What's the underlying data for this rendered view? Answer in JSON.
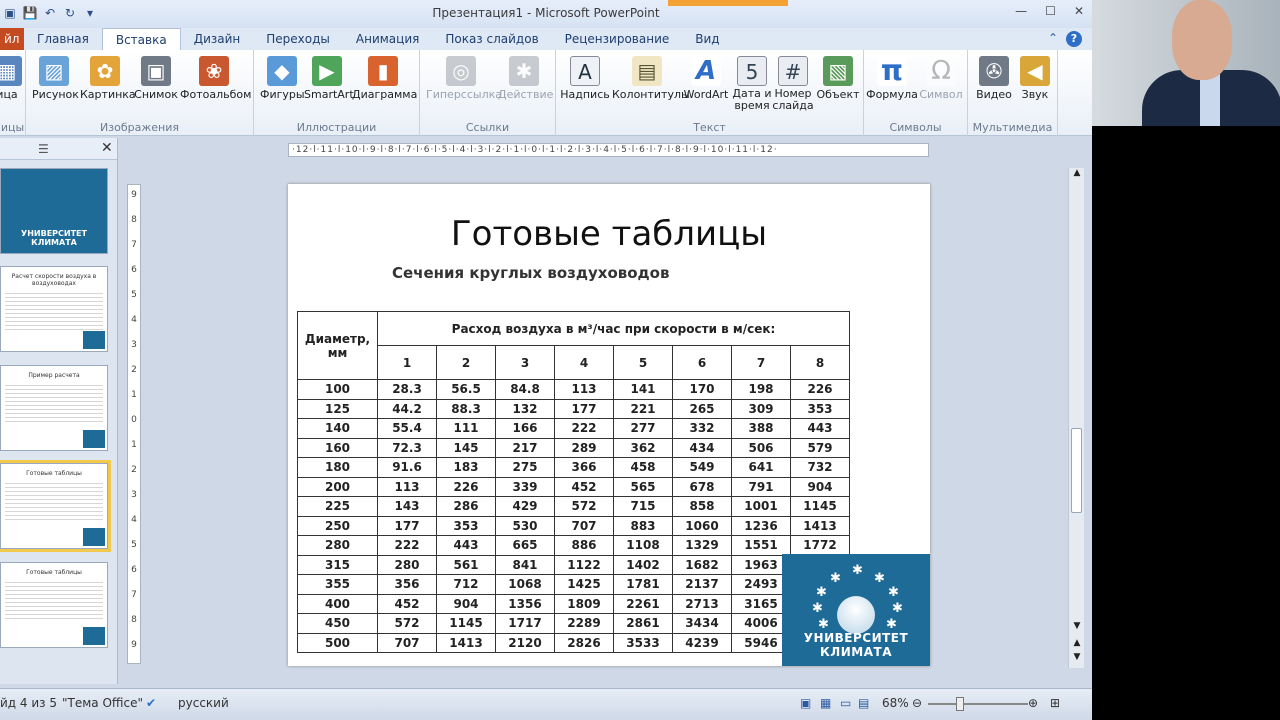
{
  "window": {
    "title": "Презентация1 - Microsoft PowerPoint"
  },
  "tabs": [
    {
      "label": "йл"
    },
    {
      "label": "Главная"
    },
    {
      "label": "Вставка"
    },
    {
      "label": "Дизайн"
    },
    {
      "label": "Переходы"
    },
    {
      "label": "Анимация"
    },
    {
      "label": "Показ слайдов"
    },
    {
      "label": "Рецензирование"
    },
    {
      "label": "Вид"
    }
  ],
  "ribbon": {
    "groups": [
      {
        "label": "ицы"
      },
      {
        "label": "Изображения"
      },
      {
        "label": "Иллюстрации"
      },
      {
        "label": "Ссылки"
      },
      {
        "label": "Текст"
      },
      {
        "label": "Символы"
      },
      {
        "label": "Мультимедиа"
      }
    ],
    "buttons": [
      {
        "label": "ица"
      },
      {
        "label": "Рисунок"
      },
      {
        "label": "Картинка"
      },
      {
        "label": "Снимок"
      },
      {
        "label": "Фотоальбом"
      },
      {
        "label": "Фигуры"
      },
      {
        "label": "SmartArt"
      },
      {
        "label": "Диаграмма"
      },
      {
        "label": "Гиперссылка"
      },
      {
        "label": "Действие"
      },
      {
        "label": "Надпись"
      },
      {
        "label": "Колонтитулы"
      },
      {
        "label": "WordArt"
      },
      {
        "label": "Дата и"
      },
      {
        "label": "время"
      },
      {
        "label": "Номер"
      },
      {
        "label": "слайда"
      },
      {
        "label": "Объект"
      },
      {
        "label": "Формула"
      },
      {
        "label": "Символ"
      },
      {
        "label": "Видео"
      },
      {
        "label": "Звук"
      }
    ]
  },
  "slides_pane": {
    "thumbs": [
      {
        "title": "УНИВЕРСИТЕТ КЛИМАТА"
      },
      {
        "title": "Расчет скорости воздуха в воздуховодах"
      },
      {
        "title": "Пример расчета"
      },
      {
        "title": "Готовые таблицы"
      },
      {
        "title": "Готовые таблицы"
      }
    ]
  },
  "rulers": {
    "horizontal": "·12·l·11·l·10·l·9·l·8·l·7·l·6·l·5·l·4·l·3·l·2·l·1·l·0·l·1·l·2·l·3·l·4·l·5·l·6·l·7·l·8·l·9·l·10·l·11·l·12·",
    "vertical": [
      "9",
      "8",
      "7",
      "6",
      "5",
      "4",
      "3",
      "2",
      "1",
      "0",
      "1",
      "2",
      "3",
      "4",
      "5",
      "6",
      "7",
      "8",
      "9"
    ]
  },
  "slide": {
    "title": "Готовые таблицы",
    "subtitle": "Сечения круглых воздуховодов",
    "table": {
      "col_header": "Диаметр, мм",
      "group_header": "Расход воздуха в м³/час при скорости в м/сек:",
      "speeds": [
        "1",
        "2",
        "3",
        "4",
        "5",
        "6",
        "7",
        "8"
      ],
      "rows": [
        [
          "100",
          "28.3",
          "56.5",
          "84.8",
          "113",
          "141",
          "170",
          "198",
          "226"
        ],
        [
          "125",
          "44.2",
          "88.3",
          "132",
          "177",
          "221",
          "265",
          "309",
          "353"
        ],
        [
          "140",
          "55.4",
          "111",
          "166",
          "222",
          "277",
          "332",
          "388",
          "443"
        ],
        [
          "160",
          "72.3",
          "145",
          "217",
          "289",
          "362",
          "434",
          "506",
          "579"
        ],
        [
          "180",
          "91.6",
          "183",
          "275",
          "366",
          "458",
          "549",
          "641",
          "732"
        ],
        [
          "200",
          "113",
          "226",
          "339",
          "452",
          "565",
          "678",
          "791",
          "904"
        ],
        [
          "225",
          "143",
          "286",
          "429",
          "572",
          "715",
          "858",
          "1001",
          "1145"
        ],
        [
          "250",
          "177",
          "353",
          "530",
          "707",
          "883",
          "1060",
          "1236",
          "1413"
        ],
        [
          "280",
          "222",
          "443",
          "665",
          "886",
          "1108",
          "1329",
          "1551",
          "1772"
        ],
        [
          "315",
          "280",
          "561",
          "841",
          "1122",
          "1402",
          "1682",
          "1963",
          ""
        ],
        [
          "355",
          "356",
          "712",
          "1068",
          "1425",
          "1781",
          "2137",
          "2493",
          ""
        ],
        [
          "400",
          "452",
          "904",
          "1356",
          "1809",
          "2261",
          "2713",
          "3165",
          ""
        ],
        [
          "450",
          "572",
          "1145",
          "1717",
          "2289",
          "2861",
          "3434",
          "4006",
          ""
        ],
        [
          "500",
          "707",
          "1413",
          "2120",
          "2826",
          "3533",
          "4239",
          "5946",
          ""
        ]
      ]
    },
    "logo_text": "УНИВЕРСИТЕТ КЛИМАТА"
  },
  "status": {
    "slide_info": "йд 4 из 5",
    "theme": "\"Тема Office\"",
    "language": "русский",
    "zoom": "68%"
  },
  "colors": {
    "accent": "#1f6b98",
    "file_tab": "#c44a20"
  }
}
